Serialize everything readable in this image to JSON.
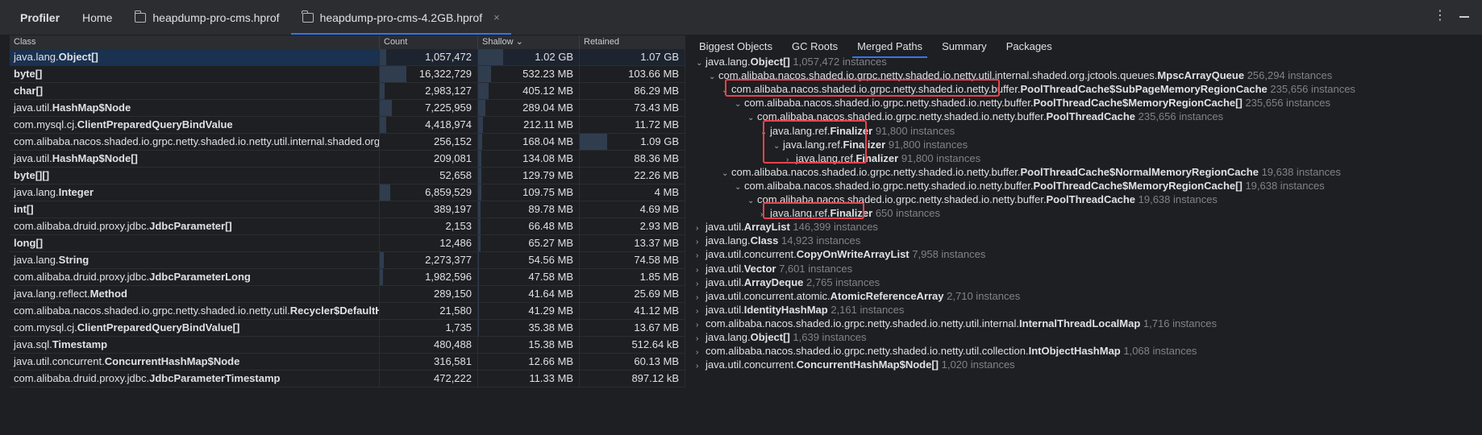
{
  "topbar": {
    "title": "Profiler",
    "tabs": [
      {
        "label": "Home"
      },
      {
        "label": "heapdump-pro-cms.hprof"
      },
      {
        "label": "heapdump-pro-cms-4.2GB.hprof"
      }
    ],
    "close_glyph": "×",
    "more_glyph": "⋮"
  },
  "table": {
    "headers": {
      "class": "Class",
      "count": "Count",
      "shallow": "Shallow ⌄",
      "retained": "Retained"
    },
    "rows": [
      {
        "pre": "java.lang.",
        "bold": "Object[]",
        "post": "",
        "count": "1,057,472",
        "shallow": "1.02 GB",
        "retained": "1.07 GB",
        "count_bar": 0.07,
        "shallow_bar": 0.25,
        "retained_bar": 0.0
      },
      {
        "pre": "",
        "bold": "byte[]",
        "post": "",
        "count": "16,322,729",
        "shallow": "532.23 MB",
        "retained": "103.66 MB",
        "count_bar": 0.27,
        "shallow_bar": 0.13,
        "retained_bar": 0.0
      },
      {
        "pre": "",
        "bold": "char[]",
        "post": "",
        "count": "2,983,127",
        "shallow": "405.12 MB",
        "retained": "86.29 MB",
        "count_bar": 0.05,
        "shallow_bar": 0.1,
        "retained_bar": 0.0
      },
      {
        "pre": "java.util.",
        "bold": "HashMap$Node",
        "post": "",
        "count": "7,225,959",
        "shallow": "289.04 MB",
        "retained": "73.43 MB",
        "count_bar": 0.12,
        "shallow_bar": 0.07,
        "retained_bar": 0.0
      },
      {
        "pre": "com.mysql.cj.",
        "bold": "ClientPreparedQueryBindValue",
        "post": "",
        "count": "4,418,974",
        "shallow": "212.11 MB",
        "retained": "11.72 MB",
        "count_bar": 0.07,
        "shallow_bar": 0.05,
        "retained_bar": 0.0
      },
      {
        "pre": "com.alibaba.nacos.shaded.io.grpc.netty.shaded.io.netty.util.internal.shaded.org.jctools.queues.MpscArrayQueue",
        "bold": "",
        "post": "",
        "count": "256,152",
        "shallow": "168.04 MB",
        "retained": "1.09 GB",
        "count_bar": 0.0,
        "shallow_bar": 0.04,
        "retained_bar": 0.26
      },
      {
        "pre": "java.util.",
        "bold": "HashMap$Node[]",
        "post": "",
        "count": "209,081",
        "shallow": "134.08 MB",
        "retained": "88.36 MB",
        "count_bar": 0.0,
        "shallow_bar": 0.03,
        "retained_bar": 0.0
      },
      {
        "pre": "",
        "bold": "byte[][]",
        "post": "",
        "count": "52,658",
        "shallow": "129.79 MB",
        "retained": "22.26 MB",
        "count_bar": 0.0,
        "shallow_bar": 0.03,
        "retained_bar": 0.0
      },
      {
        "pre": "java.lang.",
        "bold": "Integer",
        "post": "",
        "count": "6,859,529",
        "shallow": "109.75 MB",
        "retained": "4 MB",
        "count_bar": 0.11,
        "shallow_bar": 0.03,
        "retained_bar": 0.0
      },
      {
        "pre": "",
        "bold": "int[]",
        "post": "",
        "count": "389,197",
        "shallow": "89.78 MB",
        "retained": "4.69 MB",
        "count_bar": 0.0,
        "shallow_bar": 0.02,
        "retained_bar": 0.0
      },
      {
        "pre": "com.alibaba.druid.proxy.jdbc.",
        "bold": "JdbcParameter[]",
        "post": "",
        "count": "2,153",
        "shallow": "66.48 MB",
        "retained": "2.93 MB",
        "count_bar": 0.0,
        "shallow_bar": 0.02,
        "retained_bar": 0.0
      },
      {
        "pre": "",
        "bold": "long[]",
        "post": "",
        "count": "12,486",
        "shallow": "65.27 MB",
        "retained": "13.37 MB",
        "count_bar": 0.0,
        "shallow_bar": 0.02,
        "retained_bar": 0.0
      },
      {
        "pre": "java.lang.",
        "bold": "String",
        "post": "",
        "count": "2,273,377",
        "shallow": "54.56 MB",
        "retained": "74.58 MB",
        "count_bar": 0.04,
        "shallow_bar": 0.01,
        "retained_bar": 0.0
      },
      {
        "pre": "com.alibaba.druid.proxy.jdbc.",
        "bold": "JdbcParameterLong",
        "post": "",
        "count": "1,982,596",
        "shallow": "47.58 MB",
        "retained": "1.85 MB",
        "count_bar": 0.03,
        "shallow_bar": 0.01,
        "retained_bar": 0.0
      },
      {
        "pre": "java.lang.reflect.",
        "bold": "Method",
        "post": "",
        "count": "289,150",
        "shallow": "41.64 MB",
        "retained": "25.69 MB",
        "count_bar": 0.0,
        "shallow_bar": 0.01,
        "retained_bar": 0.0
      },
      {
        "pre": "com.alibaba.nacos.shaded.io.grpc.netty.shaded.io.netty.util.",
        "bold": "Recycler$DefaultHandle[]",
        "post": "",
        "count": "21,580",
        "shallow": "41.29 MB",
        "retained": "41.12 MB",
        "count_bar": 0.0,
        "shallow_bar": 0.01,
        "retained_bar": 0.0
      },
      {
        "pre": "com.mysql.cj.",
        "bold": "ClientPreparedQueryBindValue[]",
        "post": "",
        "count": "1,735",
        "shallow": "35.38 MB",
        "retained": "13.67 MB",
        "count_bar": 0.0,
        "shallow_bar": 0.01,
        "retained_bar": 0.0
      },
      {
        "pre": "java.sql.",
        "bold": "Timestamp",
        "post": "",
        "count": "480,488",
        "shallow": "15.38 MB",
        "retained": "512.64 kB",
        "count_bar": 0.0,
        "shallow_bar": 0.0,
        "retained_bar": 0.0
      },
      {
        "pre": "java.util.concurrent.",
        "bold": "ConcurrentHashMap$Node",
        "post": "",
        "count": "316,581",
        "shallow": "12.66 MB",
        "retained": "60.13 MB",
        "count_bar": 0.0,
        "shallow_bar": 0.0,
        "retained_bar": 0.0
      },
      {
        "pre": "com.alibaba.druid.proxy.jdbc.",
        "bold": "JdbcParameterTimestamp",
        "post": "",
        "count": "472,222",
        "shallow": "11.33 MB",
        "retained": "897.12 kB",
        "count_bar": 0.0,
        "shallow_bar": 0.0,
        "retained_bar": 0.0
      }
    ]
  },
  "right": {
    "tabs": [
      "Biggest Objects",
      "GC Roots",
      "Merged Paths",
      "Summary",
      "Packages"
    ],
    "active_tab": "Merged Paths",
    "tree": [
      {
        "indent": 0,
        "chev": "⌄",
        "pre": "java.lang.",
        "bold": "Object[]",
        "cnt": "1,057,472 instances"
      },
      {
        "indent": 1,
        "chev": "⌄",
        "pre": "com.alibaba.nacos.shaded.io.grpc.netty.shaded.io.netty.util.internal.shaded.org.jctools.queues.",
        "bold": "MpscArrayQueue",
        "cnt": "256,294 instances"
      },
      {
        "indent": 2,
        "chev": "⌄",
        "pre": "com.alibaba.nacos.shaded.io.grpc.netty.shaded.io.netty.buffer.",
        "bold": "PoolThreadCache$SubPageMemoryRegionCache",
        "cnt": "235,656 instances"
      },
      {
        "indent": 3,
        "chev": "⌄",
        "pre": "com.alibaba.nacos.shaded.io.grpc.netty.shaded.io.netty.buffer.",
        "bold": "PoolThreadCache$MemoryRegionCache[]",
        "cnt": "235,656 instances"
      },
      {
        "indent": 4,
        "chev": "⌄",
        "pre": "com.alibaba.nacos.shaded.io.grpc.netty.shaded.io.netty.buffer.",
        "bold": "PoolThreadCache",
        "cnt": "235,656 instances"
      },
      {
        "indent": 5,
        "chev": "⌄",
        "pre": "java.lang.ref.",
        "bold": "Finalizer",
        "cnt": "91,800 instances"
      },
      {
        "indent": 6,
        "chev": "⌄",
        "pre": "java.lang.ref.",
        "bold": "Finalizer",
        "cnt": "91,800 instances"
      },
      {
        "indent": 7,
        "chev": "›",
        "pre": "java.lang.ref.",
        "bold": "Finalizer",
        "cnt": "91,800 instances"
      },
      {
        "indent": 2,
        "chev": "⌄",
        "pre": "com.alibaba.nacos.shaded.io.grpc.netty.shaded.io.netty.buffer.",
        "bold": "PoolThreadCache$NormalMemoryRegionCache",
        "cnt": "19,638 instances"
      },
      {
        "indent": 3,
        "chev": "⌄",
        "pre": "com.alibaba.nacos.shaded.io.grpc.netty.shaded.io.netty.buffer.",
        "bold": "PoolThreadCache$MemoryRegionCache[]",
        "cnt": "19,638 instances"
      },
      {
        "indent": 4,
        "chev": "⌄",
        "pre": "com.alibaba.nacos.shaded.io.grpc.netty.shaded.io.netty.buffer.",
        "bold": "PoolThreadCache",
        "cnt": "19,638 instances"
      },
      {
        "indent": 5,
        "chev": "›",
        "pre": "java.lang.ref.",
        "bold": "Finalizer",
        "cnt": "650 instances"
      },
      {
        "indent": 0,
        "chev": "›",
        "pre": "java.util.",
        "bold": "ArrayList",
        "cnt": "146,399 instances"
      },
      {
        "indent": 0,
        "chev": "›",
        "pre": "java.lang.",
        "bold": "Class",
        "cnt": "14,923 instances"
      },
      {
        "indent": 0,
        "chev": "›",
        "pre": "java.util.concurrent.",
        "bold": "CopyOnWriteArrayList",
        "cnt": "7,958 instances"
      },
      {
        "indent": 0,
        "chev": "›",
        "pre": "java.util.",
        "bold": "Vector",
        "cnt": "7,601 instances"
      },
      {
        "indent": 0,
        "chev": "›",
        "pre": "java.util.",
        "bold": "ArrayDeque",
        "cnt": "2,765 instances"
      },
      {
        "indent": 0,
        "chev": "›",
        "pre": "java.util.concurrent.atomic.",
        "bold": "AtomicReferenceArray",
        "cnt": "2,710 instances"
      },
      {
        "indent": 0,
        "chev": "›",
        "pre": "java.util.",
        "bold": "IdentityHashMap",
        "cnt": "2,161 instances"
      },
      {
        "indent": 0,
        "chev": "›",
        "pre": "com.alibaba.nacos.shaded.io.grpc.netty.shaded.io.netty.util.internal.",
        "bold": "InternalThreadLocalMap",
        "cnt": "1,716 instances"
      },
      {
        "indent": 0,
        "chev": "›",
        "pre": "java.lang.",
        "bold": "Object[]",
        "cnt": "1,639 instances"
      },
      {
        "indent": 0,
        "chev": "›",
        "pre": "com.alibaba.nacos.shaded.io.grpc.netty.shaded.io.netty.util.collection.",
        "bold": "IntObjectHashMap",
        "cnt": "1,068 instances"
      },
      {
        "indent": 0,
        "chev": "›",
        "pre": "java.util.concurrent.",
        "bold": "ConcurrentHashMap$Node[]",
        "cnt": "1,020 instances"
      }
    ]
  }
}
